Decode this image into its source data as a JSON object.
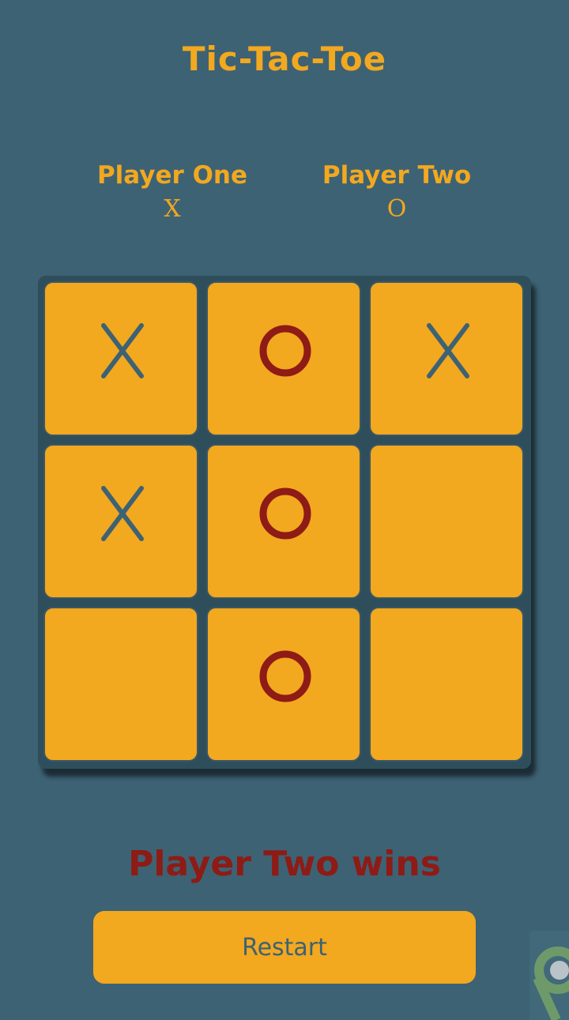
{
  "title": "Tic-Tac-Toe",
  "players": {
    "one": {
      "name": "Player One",
      "symbol": "X"
    },
    "two": {
      "name": "Player Two",
      "symbol": "O"
    }
  },
  "board": [
    "X",
    "O",
    "X",
    "X",
    "O",
    "",
    "",
    "O",
    ""
  ],
  "status": "Player Two wins",
  "restart_label": "Restart",
  "colors": {
    "background": "#3d6274",
    "accent": "#f2a81f",
    "x_mark": "#3d6274",
    "o_mark": "#8e1b15",
    "board": "#2f4e5c"
  }
}
